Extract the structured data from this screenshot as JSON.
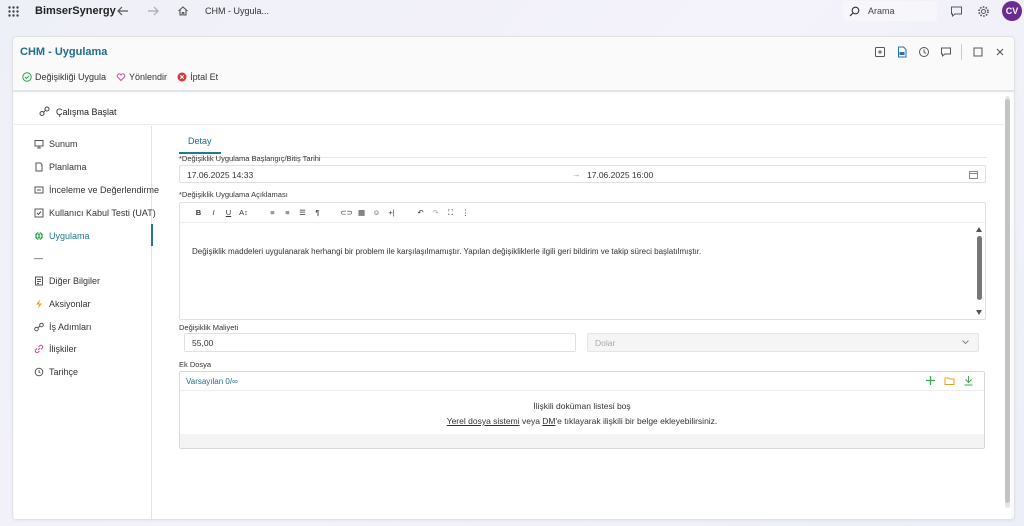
{
  "topbar": {
    "brand": "BimserSynergy",
    "tab_label": "CHM - Uygula...",
    "search_placeholder": "Arama",
    "avatar_initials": "CV"
  },
  "window": {
    "title": "CHM - Uygulama"
  },
  "toolbar": {
    "apply_label": "Değişikliği Uygula",
    "redirect_label": "Yönlendir",
    "cancel_label": "İptal Et"
  },
  "start_work_label": "Çalışma Başlat",
  "sidebar": {
    "items": [
      {
        "label": "Sunum",
        "icon": "presentation-icon"
      },
      {
        "label": "Planlama",
        "icon": "document-icon"
      },
      {
        "label": "İnceleme ve Değerlendirme",
        "icon": "review-icon"
      },
      {
        "label": "Kullanıcı Kabul Testi (UAT)",
        "icon": "test-icon"
      },
      {
        "label": "Uygulama",
        "icon": "globe-icon"
      },
      {
        "label": "—",
        "icon": ""
      },
      {
        "label": "Diğer Bilgiler",
        "icon": "info-icon"
      },
      {
        "label": "Aksiyonlar",
        "icon": "lightning-icon"
      },
      {
        "label": "İş Adımları",
        "icon": "steps-icon"
      },
      {
        "label": "İlişkiler",
        "icon": "link-icon"
      },
      {
        "label": "Tarihçe",
        "icon": "history-icon"
      }
    ]
  },
  "main": {
    "tab": "Detay",
    "date_label": "*Değişiklik Uygulama Başlangıç/Bitiş Tarihi",
    "start_date": "17.06.2025 14:33",
    "end_date": "17.06.2025 16:00",
    "desc_label": "*Değişiklik Uygulama Açıklaması",
    "desc_text": "Değişiklik maddeleri uygulanarak herhangi bir problem ile karşılaşılmamıştır. Yapılan değişikliklerle ilgili geri bildirim ve takip süreci başlatılmıştır.",
    "cost_label": "Değişiklik Maliyeti",
    "cost_value": "55,00",
    "currency_value": "Dolar",
    "attach_label": "Ek Dosya",
    "attach_header": "Varsayılan 0/∞",
    "attach_empty_title": "İlişkili doküman listesi boş",
    "attach_link1": "Yerel dosya sistemi",
    "attach_mid": " veya ",
    "attach_link2": "DM",
    "attach_tail": "'e tıklayarak ilişkili bir belge ekleyebilirsiniz."
  },
  "colors": {
    "accent": "#1e7c8c",
    "title": "#1e6e8c",
    "avatar": "#6a2c91",
    "apply_icon": "#2e9e4f",
    "redirect_icon": "#c74b9b",
    "cancel_icon": "#d93838",
    "add_icon": "#3aaa4a",
    "folder_icon": "#e8a020"
  }
}
